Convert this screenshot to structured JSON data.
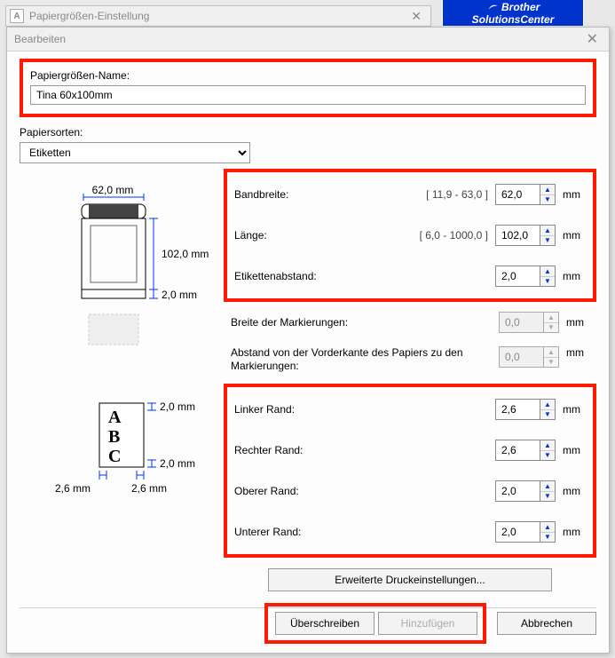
{
  "brother": {
    "line1": "Brother",
    "line2": "SolutionsCenter"
  },
  "outerWindow": {
    "title": "Papiergrößen-Einstellung"
  },
  "dialog": {
    "title": "Bearbeiten"
  },
  "name": {
    "label": "Papiergrößen-Name:",
    "value": "Tina 60x100mm"
  },
  "paperTypes": {
    "label": "Papiersorten:",
    "selected": "Etiketten"
  },
  "preview": {
    "width_label": "62,0 mm",
    "length_label": "102,0 mm",
    "gap_label": "2,0 mm",
    "abc": "A\nB\nC",
    "top_margin": "2,0 mm",
    "bottom_margin": "2,0 mm",
    "left_margin": "2,6 mm",
    "right_margin": "2,6 mm"
  },
  "fields": {
    "tapeWidth": {
      "label": "Bandbreite:",
      "range": "[ 11,9 - 63,0 ]",
      "value": "62,0",
      "unit": "mm"
    },
    "length": {
      "label": "Länge:",
      "range": "[ 6,0 - 1000,0 ]",
      "value": "102,0",
      "unit": "mm"
    },
    "labelGap": {
      "label": "Etikettenabstand:",
      "value": "2,0",
      "unit": "mm"
    },
    "markWidth": {
      "label": "Breite der Markierungen:",
      "value": "0,0",
      "unit": "mm"
    },
    "markDist": {
      "label": "Abstand von der Vorderkante des Papiers zu den Markierungen:",
      "value": "0,0",
      "unit": "mm"
    },
    "leftMargin": {
      "label": "Linker Rand:",
      "value": "2,6",
      "unit": "mm"
    },
    "rightMargin": {
      "label": "Rechter Rand:",
      "value": "2,6",
      "unit": "mm"
    },
    "topMargin": {
      "label": "Oberer Rand:",
      "value": "2,0",
      "unit": "mm"
    },
    "bottomMargin": {
      "label": "Unterer Rand:",
      "value": "2,0",
      "unit": "mm"
    }
  },
  "buttons": {
    "advanced": "Erweiterte Druckeinstellungen...",
    "overwrite": "Überschreiben",
    "add": "Hinzufügen",
    "cancel": "Abbrechen"
  }
}
